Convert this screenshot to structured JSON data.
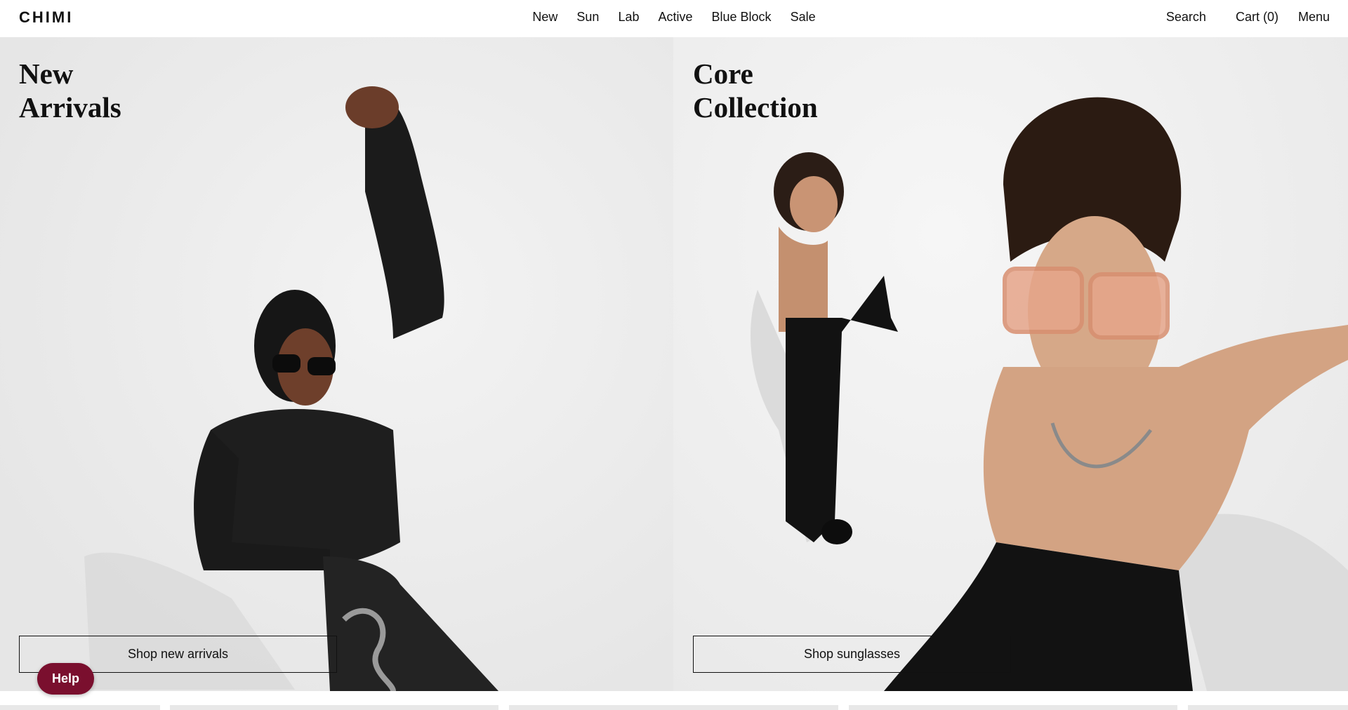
{
  "header": {
    "logo": "CHIMI",
    "nav": [
      "New",
      "Sun",
      "Lab",
      "Active",
      "Blue Block",
      "Sale"
    ],
    "search": "Search",
    "cart": "Cart (0)",
    "menu": "Menu"
  },
  "panels": {
    "left": {
      "title": "New\nArrivals",
      "button": "Shop new arrivals"
    },
    "right": {
      "title": "Core\nCollection",
      "button": "Shop sunglasses"
    }
  },
  "help": "Help",
  "colors": {
    "help_bg": "#7a0f2e",
    "text": "#111111",
    "bg": "#ffffff"
  }
}
